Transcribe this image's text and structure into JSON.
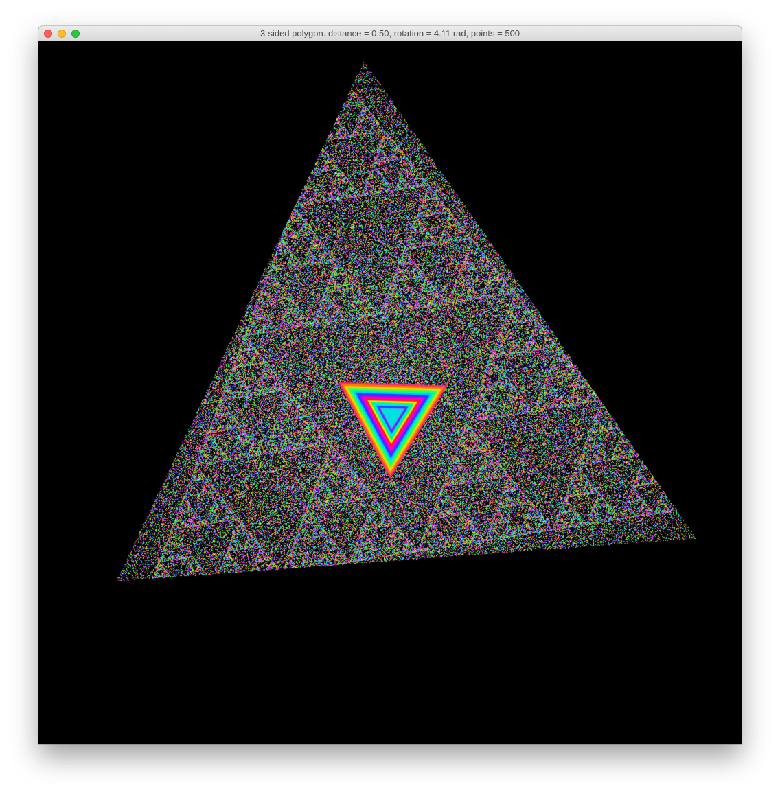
{
  "window": {
    "title": "3-sided polygon. distance = 0.50, rotation = 4.11 rad, points = 500",
    "controls": [
      "close-button",
      "minimize-button",
      "zoom-button"
    ]
  },
  "fractal": {
    "sides": 3,
    "distance": 0.5,
    "rotation_rad": 4.11,
    "points": 500,
    "background": "#000000"
  }
}
